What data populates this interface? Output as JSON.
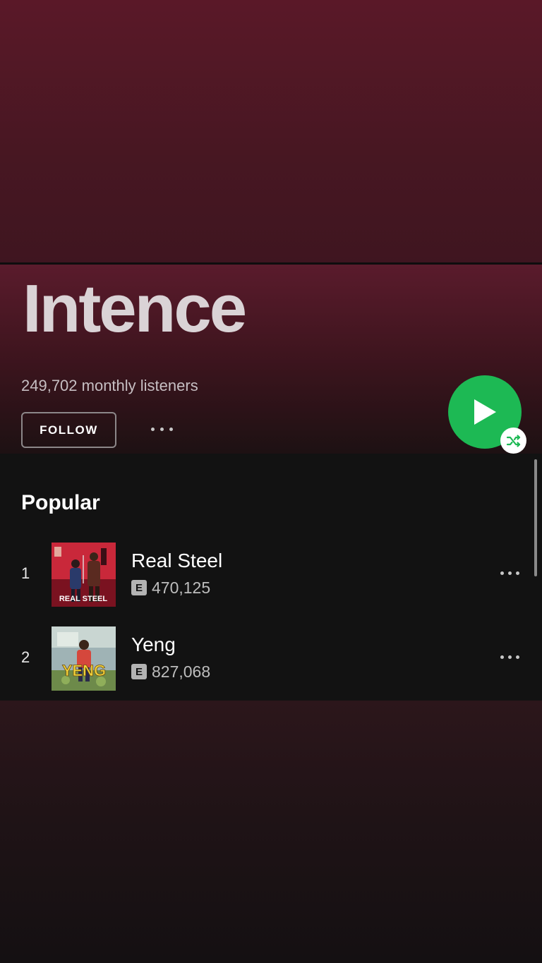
{
  "artist": {
    "name": "Intence",
    "monthly_listeners": "249,702 monthly listeners",
    "follow_label": "FOLLOW"
  },
  "popular": {
    "title": "Popular",
    "tracks": [
      {
        "index": "1",
        "title": "Real Steel",
        "explicit": "E",
        "plays": "470,125",
        "cover_text": "REAL STEEL"
      },
      {
        "index": "2",
        "title": "Yeng",
        "explicit": "E",
        "plays": "827,068",
        "cover_text": "YENG"
      }
    ]
  },
  "colors": {
    "accent": "#1db954",
    "header_gradient_top": "#5a1828",
    "background": "#121212"
  },
  "icons": {
    "play": "play-icon",
    "shuffle": "shuffle-icon",
    "more": "more-options-icon"
  }
}
